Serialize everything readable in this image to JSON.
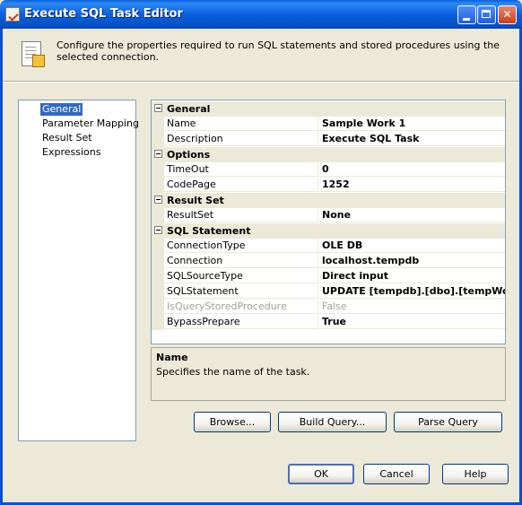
{
  "window": {
    "title": "Execute SQL Task Editor"
  },
  "header": {
    "text": "Configure the properties required to run SQL statements and stored procedures using the selected connection."
  },
  "nav": {
    "items": [
      {
        "label": "General",
        "selected": true
      },
      {
        "label": "Parameter Mapping",
        "selected": false
      },
      {
        "label": "Result Set",
        "selected": false
      },
      {
        "label": "Expressions",
        "selected": false
      }
    ]
  },
  "grid": {
    "categories": [
      {
        "name": "General",
        "props": [
          {
            "name": "Name",
            "value": "Sample Work 1"
          },
          {
            "name": "Description",
            "value": "Execute SQL Task"
          }
        ]
      },
      {
        "name": "Options",
        "props": [
          {
            "name": "TimeOut",
            "value": "0"
          },
          {
            "name": "CodePage",
            "value": "1252"
          }
        ]
      },
      {
        "name": "Result Set",
        "props": [
          {
            "name": "ResultSet",
            "value": "None"
          }
        ]
      },
      {
        "name": "SQL Statement",
        "props": [
          {
            "name": "ConnectionType",
            "value": "OLE DB"
          },
          {
            "name": "Connection",
            "value": "localhost.tempdb"
          },
          {
            "name": "SQLSourceType",
            "value": "Direct input"
          },
          {
            "name": "SQLStatement",
            "value": "UPDATE [tempdb].[dbo].[tempWork"
          },
          {
            "name": "IsQueryStoredProcedure",
            "value": "False",
            "disabled": true
          },
          {
            "name": "BypassPrepare",
            "value": "True"
          }
        ]
      }
    ]
  },
  "description": {
    "title": "Name",
    "text": "Specifies the name of the task."
  },
  "buttons": {
    "browse": "Browse...",
    "build_query": "Build Query...",
    "parse_query": "Parse Query",
    "ok": "OK",
    "cancel": "Cancel",
    "help": "Help"
  },
  "colors": {
    "titlebar": "#0a5fd8",
    "dialog_bg": "#ece9d8",
    "selection": "#316ac5"
  }
}
